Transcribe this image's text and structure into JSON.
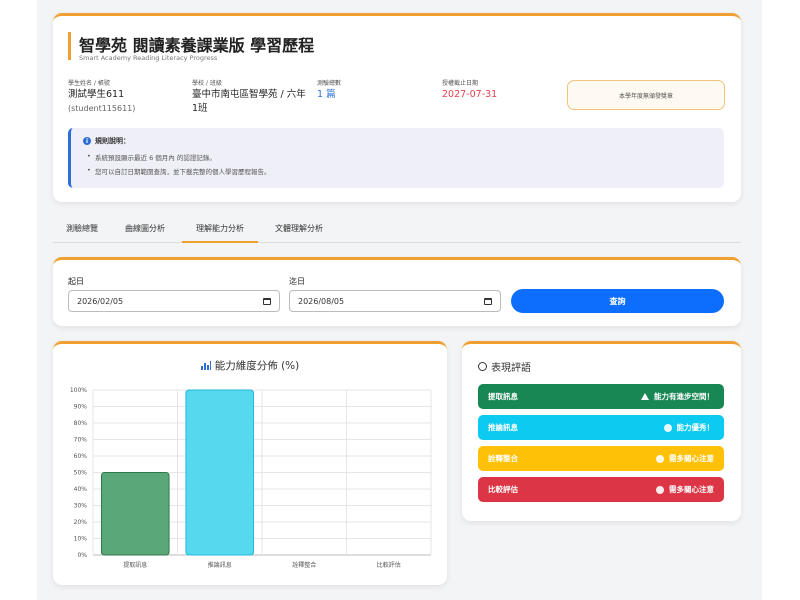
{
  "header": {
    "title": "智學苑 閱讀素養課業版 學習歷程",
    "subtitle": "Smart Academy Reading Literacy Progress",
    "student_label": "學生姓名 / 帳號",
    "student_name": "測試學生611",
    "student_account": "(student115611)",
    "school_label": "學校 / 班級",
    "school_line1": "臺中市南屯區智學苑 / 六年",
    "school_line2": "1班",
    "tests_label": "測驗總數",
    "tests_value": "1 篇",
    "expire_label": "授權截止日期",
    "expire_value": "2027-07-31",
    "award_button": "本學年度無頒發獎章",
    "rules_title": "規則說明：",
    "rules": [
      "系統預設顯示最近 6 個月內 的認證記錄。",
      "您可以自訂日期範圍查詢，並下載完整的個人學習歷程報告。"
    ]
  },
  "tabs": [
    "測驗總覽",
    "曲線圖分析",
    "理解能力分析",
    "文體理解分析"
  ],
  "active_tab": 2,
  "filter": {
    "start_label": "起日",
    "start_value": "2026/02/05",
    "end_label": "迄日",
    "end_value": "2026/08/05",
    "query_button": "查詢"
  },
  "chart_card": {
    "title": "能力維度分佈 (%)"
  },
  "chart_data": {
    "type": "bar",
    "title": "能力維度分佈 (%)",
    "categories": [
      "提取訊息",
      "推論訊息",
      "詮釋整合",
      "比較評估"
    ],
    "values": [
      50,
      100,
      0,
      0
    ],
    "ylim": [
      0,
      100
    ],
    "yticks": [
      "0%",
      "10%",
      "20%",
      "30%",
      "40%",
      "50%",
      "60%",
      "70%",
      "80%",
      "90%",
      "100%"
    ],
    "colors": [
      "#5aa77a",
      "#56d8ee"
    ],
    "border_colors": [
      "#2f7a4d",
      "#22b8d6"
    ],
    "grid": true
  },
  "comments": {
    "title": "表現評語",
    "items": [
      {
        "label": "提取訊息",
        "comment": "能力有進步空間！",
        "icon": "warning-icon",
        "color": "#198754"
      },
      {
        "label": "推論訊息",
        "comment": "能力優秀！",
        "icon": "check-circle-icon",
        "color": "#0dcaf0"
      },
      {
        "label": "詮釋整合",
        "comment": "需多關心注意",
        "icon": "x-circle-icon",
        "color": "#ffc107"
      },
      {
        "label": "比較評估",
        "comment": "需多關心注意",
        "icon": "x-circle-icon",
        "color": "#dc3545"
      }
    ]
  }
}
